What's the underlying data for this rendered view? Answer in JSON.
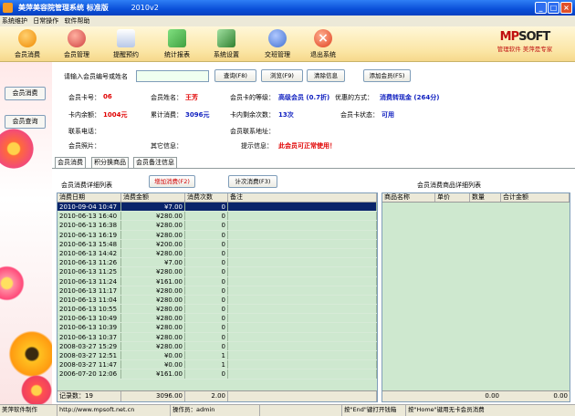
{
  "window": {
    "title": "美萍美容院管理系统 标准版",
    "version": "2010v2",
    "min": "_",
    "max": "□",
    "close": "×"
  },
  "menu": [
    "系统维护",
    "日常操作",
    "软件帮助"
  ],
  "toolbar": [
    {
      "label": "会员消费",
      "icon": "play-icon",
      "color": "#f08a00"
    },
    {
      "label": "会员管理",
      "icon": "warning-icon",
      "color": "#d04040"
    },
    {
      "label": "提醒预约",
      "icon": "notepad-icon",
      "color": "#6080c0"
    },
    {
      "label": "统计报表",
      "icon": "chart-icon",
      "color": "#40a040"
    },
    {
      "label": "系统设置",
      "icon": "gear-box-icon",
      "color": "#40a040"
    },
    {
      "label": "交班管理",
      "icon": "users-icon",
      "color": "#4070d0"
    },
    {
      "label": "退出系统",
      "icon": "close-circle-icon",
      "color": "#e04020"
    }
  ],
  "logo": {
    "mp": "MP",
    "soft": "SOFT",
    "tagline": "管理软件 美萍是专家"
  },
  "colors": {
    "accent": "#e00000",
    "title_blue": "#0a4fd8",
    "grid_green": "#cee8cf",
    "selected": "#0a246a"
  },
  "sidebar": {
    "buttons": [
      "会员消费",
      "会员查询"
    ]
  },
  "search": {
    "label": "请输入会员编号或姓名",
    "value": "",
    "query_btn": "查询(F8)",
    "browse_btn": "浏览(F9)",
    "clear_btn": "清除信息",
    "add_btn": "添加会员(F5)"
  },
  "member": {
    "card_no_label": "会员卡号：",
    "card_no": "06",
    "name_label": "会员姓名：",
    "name": "王芳",
    "level_label": "会员卡的等级：",
    "level": "高级会员 (0.7折)",
    "discount_label": "优惠的方式：",
    "discount": "消费转现金 (264分)",
    "balance_label": "卡内余额：",
    "balance": "1004元",
    "total_label": "累计消费：",
    "total": "3096元",
    "remaining_label": "卡内剩余次数：",
    "remaining": "13次",
    "status_label": "会员卡状态：",
    "status": "可用",
    "phone_label": "联系电话：",
    "phone": "",
    "address_label": "会员联系地址：",
    "address": "",
    "photo_label": "会员照片：",
    "other_label": "其它信息：",
    "hint_label": "提示信息：",
    "hint": "此会员可正常使用！"
  },
  "tabs": [
    "会员消费",
    "积分换商品",
    "会员备注信息"
  ],
  "consume": {
    "title": "会员消费详细列表",
    "add_btn": "增加消费(F2)",
    "count_btn": "计次消费(F3)",
    "headers": [
      "消费日期",
      "消费金额",
      "消费次数",
      "备注"
    ],
    "rows": [
      [
        "2010-09-04 10:47",
        "¥7.00",
        "0",
        ""
      ],
      [
        "2010-06-13 16:40",
        "¥280.00",
        "0",
        ""
      ],
      [
        "2010-06-13 16:38",
        "¥280.00",
        "0",
        ""
      ],
      [
        "2010-06-13 16:19",
        "¥280.00",
        "0",
        ""
      ],
      [
        "2010-06-13 15:48",
        "¥200.00",
        "0",
        ""
      ],
      [
        "2010-06-13 14:42",
        "¥280.00",
        "0",
        ""
      ],
      [
        "2010-06-13 11:26",
        "¥7.00",
        "0",
        ""
      ],
      [
        "2010-06-13 11:25",
        "¥280.00",
        "0",
        ""
      ],
      [
        "2010-06-13 11:24",
        "¥161.00",
        "0",
        ""
      ],
      [
        "2010-06-13 11:17",
        "¥280.00",
        "0",
        ""
      ],
      [
        "2010-06-13 11:04",
        "¥280.00",
        "0",
        ""
      ],
      [
        "2010-06-13 10:55",
        "¥280.00",
        "0",
        ""
      ],
      [
        "2010-06-13 10:49",
        "¥280.00",
        "0",
        ""
      ],
      [
        "2010-06-13 10:39",
        "¥280.00",
        "0",
        ""
      ],
      [
        "2010-06-13 10:37",
        "¥280.00",
        "0",
        ""
      ],
      [
        "2008-03-27 15:29",
        "¥280.00",
        "0",
        ""
      ],
      [
        "2008-03-27 12:51",
        "¥0.00",
        "1",
        ""
      ],
      [
        "2008-03-27 11:47",
        "¥0.00",
        "1",
        ""
      ],
      [
        "2006-07-20 12:06",
        "¥161.00",
        "0",
        ""
      ]
    ],
    "footer": [
      "记录数：19",
      "3096.00",
      "2.00"
    ]
  },
  "detail": {
    "title": "会员消费商品详细列表",
    "headers": [
      "商品名称",
      "单价",
      "数量",
      "合计金额"
    ],
    "footer": [
      "",
      "",
      "0.00",
      "0.00"
    ]
  },
  "status": [
    "美萍软件制作",
    "http://www.mpsoft.net.cn",
    "操作员：admin",
    "",
    "按\"End\"键打开钱箱",
    "按\"Home\"键用无卡会员消费"
  ]
}
